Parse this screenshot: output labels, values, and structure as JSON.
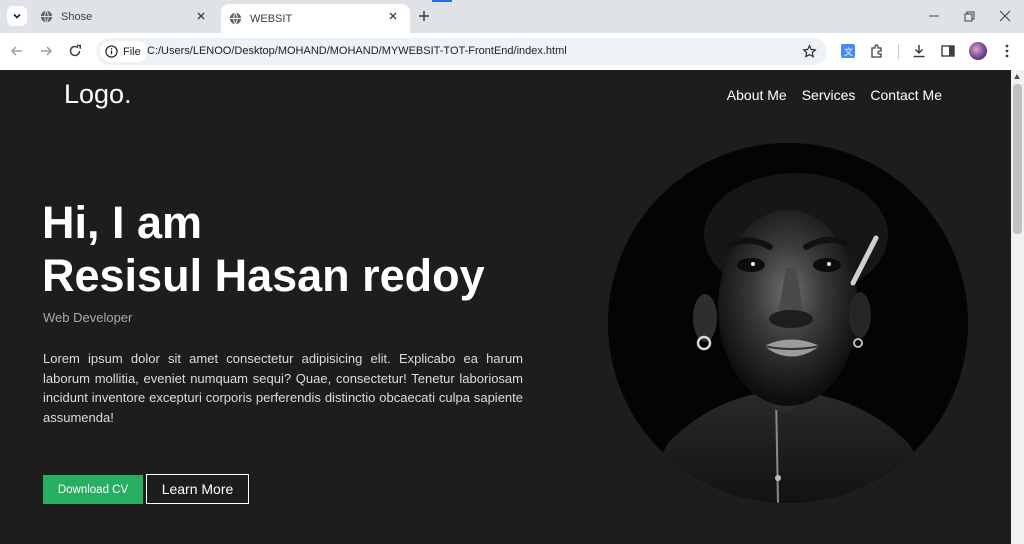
{
  "browser": {
    "tabs": [
      {
        "title": "Shose",
        "active": false
      },
      {
        "title": "WEBSIT",
        "active": true
      }
    ],
    "omnibox": {
      "chip_label": "File",
      "url": "C:/Users/LENOO/Desktop/MOHAND/MOHAND/MYWEBSIT-TOT-FrontEnd/index.html"
    },
    "accent_color": "#1a73e8"
  },
  "site": {
    "logo": "Logo.",
    "nav": [
      "About Me",
      "Services",
      "Contact Me"
    ],
    "hero": {
      "greeting": "Hi, I am",
      "name": "Resisul Hasan redoy",
      "role": "Web Developer",
      "description": "Lorem ipsum dolor sit amet consectetur adipisicing elit. Explicabo ea harum laborum mollitia, eveniet numquam sequi? Quae, consectetur! Tenetur laboriosam incidunt inventore excepturi corporis perferendis distinctio obcaecati culpa sapiente assumenda!",
      "primary_button": "Download CV",
      "secondary_button": "Learn More"
    },
    "colors": {
      "background": "#1d1d1d",
      "primary_button": "#27ae60"
    }
  }
}
